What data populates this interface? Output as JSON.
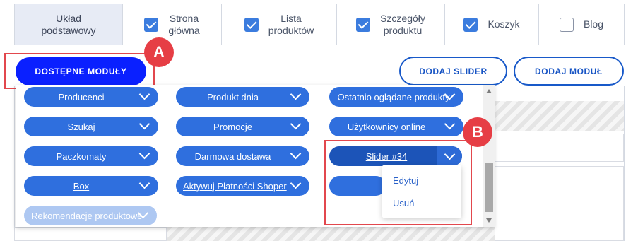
{
  "layout_tabs": [
    {
      "id": "base",
      "label_line1": "Układ",
      "label_line2": "podstawowy",
      "checked": null
    },
    {
      "id": "home",
      "label_line1": "Strona",
      "label_line2": "główna",
      "checked": true
    },
    {
      "id": "list",
      "label_line1": "Lista",
      "label_line2": "produktów",
      "checked": true
    },
    {
      "id": "details",
      "label_line1": "Szczegóły",
      "label_line2": "produktu",
      "checked": true
    },
    {
      "id": "cart",
      "label_line1": "Koszyk",
      "label_line2": "",
      "checked": true
    },
    {
      "id": "blog",
      "label_line1": "Blog",
      "label_line2": "",
      "checked": false
    }
  ],
  "toolbar": {
    "available_modules_label": "DOSTĘPNE MODUŁY",
    "add_slider_label": "DODAJ SLIDER",
    "add_module_label": "DODAJ MODUŁ"
  },
  "markers": {
    "a": "A",
    "b": "B"
  },
  "modules": {
    "col1": [
      "Producenci",
      "Szukaj",
      "Paczkomaty",
      "Box",
      "Rekomendacje produktowe"
    ],
    "col2": [
      "Produkt dnia",
      "Promocje",
      "Darmowa dostawa",
      "Aktywuj Płatności Shoper"
    ],
    "col3": [
      "Ostatnio oglądane produkty",
      "Użytkownicy online",
      "Slider #34"
    ]
  },
  "context_menu": {
    "edit": "Edytuj",
    "delete": "Usuń"
  },
  "colors": {
    "accent": "#2f6fde",
    "primary_button": "#0a20ff",
    "highlight": "#e2474d"
  }
}
